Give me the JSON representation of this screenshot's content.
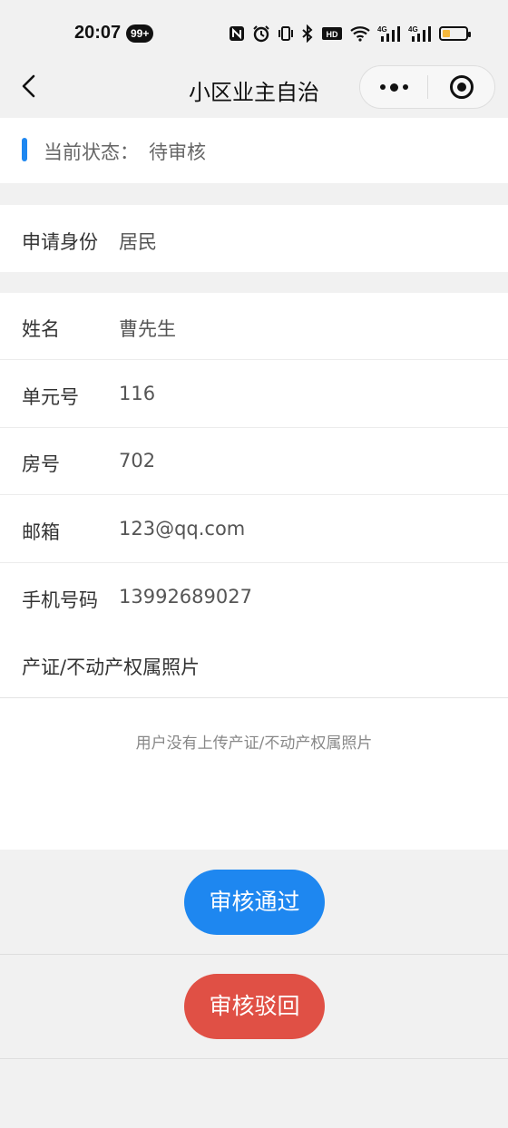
{
  "status_bar": {
    "time": "20:07",
    "badge": "99+",
    "icons": [
      "nfc-icon",
      "alarm-icon",
      "vibrate-icon",
      "bluetooth-icon",
      "hd-icon",
      "wifi-icon",
      "signal-4g-icon",
      "signal-4g-icon",
      "battery-icon"
    ],
    "hd_label": "HD",
    "net1": "4G",
    "net2": "4G"
  },
  "nav": {
    "title": "小区业主自治"
  },
  "status": {
    "label": "当前状态：",
    "value": "待审核"
  },
  "identity": {
    "label": "申请身份",
    "value": "居民"
  },
  "fields": [
    {
      "label": "姓名",
      "value": "曹先生"
    },
    {
      "label": "单元号",
      "value": "116"
    },
    {
      "label": "房号",
      "value": "702"
    },
    {
      "label": "邮箱",
      "value": "123@qq.com"
    },
    {
      "label": "手机号码",
      "value": "13992689027"
    }
  ],
  "photo": {
    "label": "产证/不动产权属照片",
    "empty_text": "用户没有上传产证/不动产权属照片"
  },
  "actions": {
    "approve_label": "审核通过",
    "reject_label": "审核驳回"
  },
  "colors": {
    "accent": "#1e87f0",
    "danger": "#e05045",
    "background": "#f1f1f1"
  }
}
